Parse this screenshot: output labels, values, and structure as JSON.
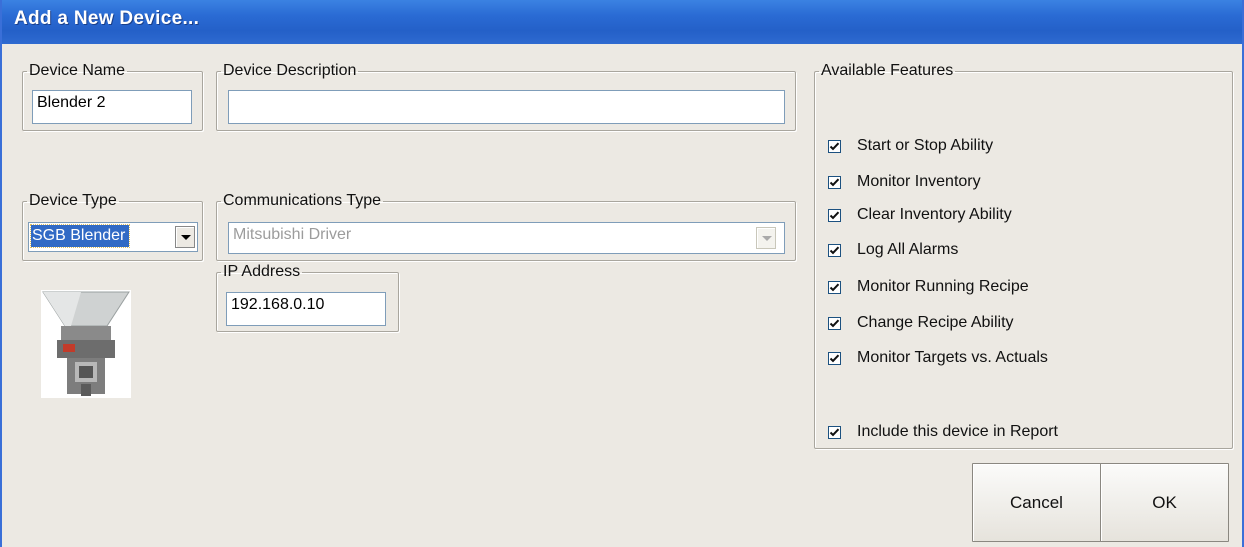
{
  "window": {
    "title": "Add a New Device..."
  },
  "device_name": {
    "legend": "Device Name",
    "value": "Blender 2"
  },
  "device_description": {
    "legend": "Device Description",
    "value": ""
  },
  "device_type": {
    "legend": "Device Type",
    "selected": "SGB Blender"
  },
  "communications_type": {
    "legend": "Communications Type",
    "selected": "Mitsubishi Driver"
  },
  "ip_address": {
    "legend": "IP Address",
    "value": "192.168.0.10"
  },
  "features": {
    "legend": "Available Features",
    "items": [
      {
        "label": "Start or Stop Ability",
        "checked": true
      },
      {
        "label": "Monitor Inventory",
        "checked": true
      },
      {
        "label": "Clear Inventory Ability",
        "checked": true
      },
      {
        "label": "Log All Alarms",
        "checked": true
      },
      {
        "label": "Monitor Running Recipe",
        "checked": true
      },
      {
        "label": "Change Recipe Ability",
        "checked": true
      },
      {
        "label": "Monitor Targets vs. Actuals",
        "checked": true
      }
    ],
    "include_report": {
      "label": "Include this device in Report",
      "checked": true
    }
  },
  "buttons": {
    "cancel": "Cancel",
    "ok": "OK"
  },
  "colors": {
    "titlebar": "#2a6bd4",
    "selection": "#316ac5",
    "dialog_bg": "#ece9e3"
  }
}
